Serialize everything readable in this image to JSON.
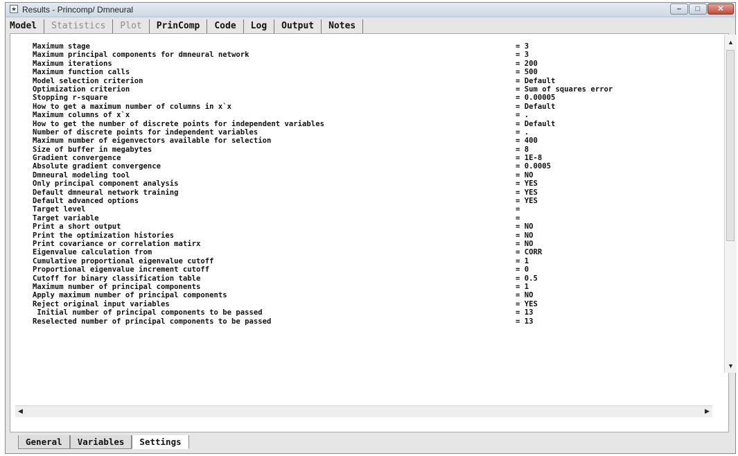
{
  "window": {
    "title": "Results - Princomp/ Dmneural",
    "icon": "results-icon"
  },
  "top_tabs": [
    {
      "label": "Model",
      "enabled": true
    },
    {
      "label": "Statistics",
      "enabled": false
    },
    {
      "label": "Plot",
      "enabled": false
    },
    {
      "label": "PrinComp",
      "enabled": true
    },
    {
      "label": "Code",
      "enabled": true
    },
    {
      "label": "Log",
      "enabled": true
    },
    {
      "label": "Output",
      "enabled": true
    },
    {
      "label": "Notes",
      "enabled": true
    }
  ],
  "settings": {
    "rows": [
      {
        "label": "Maximum stage",
        "value": "= 3"
      },
      {
        "label": "Maximum principal components for dmneural network",
        "value": "= 3"
      },
      {
        "label": "Maximum iterations",
        "value": "= 200"
      },
      {
        "label": "Maximum function calls",
        "value": "= 500"
      },
      {
        "label": "Model selection criterion",
        "value": "= Default"
      },
      {
        "label": "Optimization criterion",
        "value": "= Sum of squares error"
      },
      {
        "label": "Stopping r-square",
        "value": "= 0.00005"
      },
      {
        "label": "How to get a maximum number of columns in x`x",
        "value": "= Default"
      },
      {
        "label": "Maximum columns of x`x",
        "value": "= ."
      },
      {
        "label": "How to get the number of discrete points for independent variables",
        "value": "= Default"
      },
      {
        "label": "Number of discrete points for independent variables",
        "value": "= ."
      },
      {
        "label": "Maximum number of eigenvectors available for selection",
        "value": "= 400"
      },
      {
        "label": "Size of buffer in megabytes",
        "value": "= 8"
      },
      {
        "label": "Gradient convergence",
        "value": "= 1E-8"
      },
      {
        "label": "Absolute gradient convergence",
        "value": "= 0.0005"
      },
      {
        "label": "Dmneural modeling tool",
        "value": "= NO"
      },
      {
        "label": "Only principal component analysis",
        "value": "= YES"
      },
      {
        "label": "Default dmneural network training",
        "value": "= YES"
      },
      {
        "label": "Default advanced options",
        "value": "= YES"
      },
      {
        "label": "Target level",
        "value": "="
      },
      {
        "label": "Target variable",
        "value": "="
      },
      {
        "label": "Print a short output",
        "value": "= NO"
      },
      {
        "label": "Print the optimization histories",
        "value": "= NO"
      },
      {
        "label": "Print covariance or correlation matirx",
        "value": "= NO"
      },
      {
        "label": "Eigenvalue calculation from",
        "value": "= CORR"
      },
      {
        "label": "Cumulative proportional eigenvalue cutoff",
        "value": "= 1"
      },
      {
        "label": "Proportional eigenvalue increment cutoff",
        "value": "= 0"
      },
      {
        "label": "Cutoff for binary classification table",
        "value": "= 0.5"
      },
      {
        "label": "Maximum number of principal components",
        "value": "= 1"
      },
      {
        "label": "Apply maximum number of principal components",
        "value": "= NO"
      },
      {
        "label": "Reject original input variables",
        "value": "= YES"
      },
      {
        "label": " Initial number of principal components to be passed",
        "value": "= 13"
      },
      {
        "label": "Reselected number of principal components to be passed",
        "value": "= 13"
      }
    ]
  },
  "bottom_tabs": [
    {
      "label": "General",
      "active": false
    },
    {
      "label": "Variables",
      "active": false
    },
    {
      "label": "Settings",
      "active": true
    }
  ]
}
